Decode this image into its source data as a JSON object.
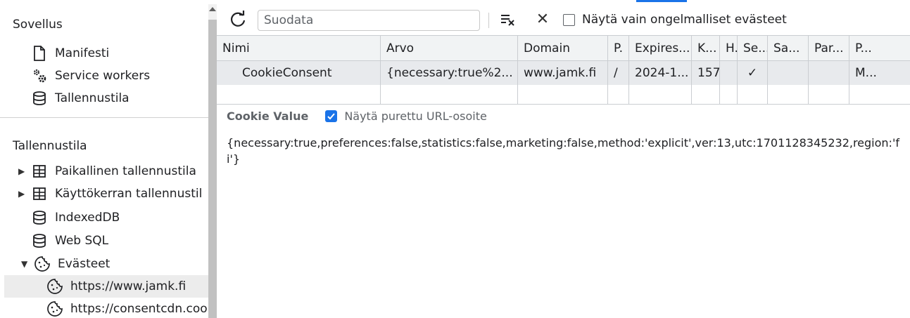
{
  "sidebar": {
    "app_section": {
      "title": "Sovellus",
      "items": [
        {
          "label": "Manifesti",
          "icon": "document-icon"
        },
        {
          "label": "Service workers",
          "icon": "gears-icon"
        },
        {
          "label": "Tallennustila",
          "icon": "database-icon"
        }
      ]
    },
    "storage_section": {
      "title": "Tallennustila",
      "items": [
        {
          "label": "Paikallinen tallennustila",
          "icon": "table-icon",
          "expandable": true
        },
        {
          "label": "Käyttökerran tallennustil",
          "icon": "table-icon",
          "expandable": true
        },
        {
          "label": "IndexedDB",
          "icon": "database-icon"
        },
        {
          "label": "Web SQL",
          "icon": "database-icon"
        },
        {
          "label": "Evästeet",
          "icon": "cookie-icon",
          "expanded": true
        },
        {
          "label": "https://www.jamk.fi",
          "icon": "cookie-icon",
          "selected": true
        },
        {
          "label": "https://consentcdn.coo",
          "icon": "cookie-icon"
        }
      ]
    }
  },
  "toolbar": {
    "filter_placeholder": "Suodata",
    "only_issues_label": "Näytä vain ongelmalliset evästeet"
  },
  "table": {
    "headers": [
      "Nimi",
      "Arvo",
      "Domain",
      "P.",
      "Expires...",
      "K...",
      "H.",
      "Se...",
      "Sa...",
      "Par...",
      "P..."
    ],
    "rows": [
      [
        "CookieConsent",
        "{necessary:true%2...",
        "www.jamk.fi",
        "/",
        "2024-1...",
        "157",
        "",
        "✓",
        "",
        "",
        "M..."
      ]
    ]
  },
  "cookie_value": {
    "title": "Cookie Value",
    "decode_label": "Näytä purettu URL-osoite",
    "decode_checked": true,
    "value": "{necessary:true,preferences:false,statistics:false,marketing:false,method:'explicit',ver:13,utc:1701128345232,region:'fi'}"
  },
  "colors": {
    "accent": "#1a73e8",
    "header_bg": "#f1f3f4",
    "selected_row_bg": "#e8eaed",
    "selected_tree_bg": "#ececec"
  }
}
